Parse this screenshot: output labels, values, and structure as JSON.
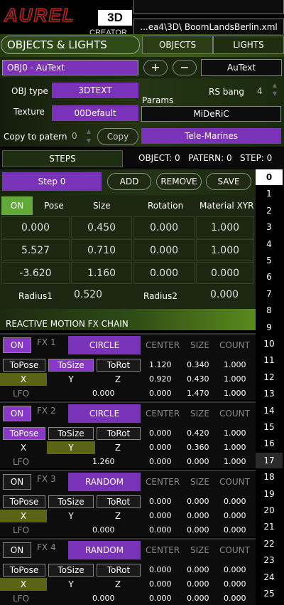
{
  "app": {
    "logo_main": "AUREL",
    "logo_3d": "3D",
    "logo_sub": "CREATOR",
    "file": "...ea4\\3D\\ BoomLandsBerlin.xml"
  },
  "header": {
    "title": "OBJECTS & LIGHTS",
    "tab_objects": "OBJECTS",
    "tab_lights": "LIGHTS"
  },
  "object": {
    "selector": "OBJ0 - AuText",
    "plus": "+",
    "minus": "−",
    "name": "AuText",
    "type_label": "OBJ type",
    "type_value": "3DTEXT",
    "rs_label": "RS bang",
    "rs_value": "4",
    "texture_label": "Texture",
    "texture_value": "00Default",
    "params_label": "Params",
    "params_value": "MiDeRiC",
    "copy_label": "Copy to patern",
    "copy_value": "0",
    "copy_button": "Copy",
    "pattern_name": "Tele-Marines"
  },
  "steps": {
    "label": "STEPS",
    "status": "OBJECT: 0   PATERN: 0   STEP: 0",
    "step_name": "Step 0",
    "add": "ADD",
    "remove": "REMOVE",
    "save": "SAVE"
  },
  "transform": {
    "on": "ON",
    "headers": [
      "Pose",
      "Size",
      "Rotation",
      "Material XYR"
    ],
    "rows": [
      [
        "0.000",
        "0.450",
        "0.000",
        "1.000"
      ],
      [
        "5.527",
        "0.710",
        "0.000",
        "1.000"
      ],
      [
        "-3.620",
        "1.160",
        "0.000",
        "0.000"
      ]
    ],
    "radius1_label": "Radius1",
    "radius1_value": "0.520",
    "radius2_label": "Radius2",
    "radius2_value": "0.000"
  },
  "fx": {
    "title": "REACTIVE MOTION FX CHAIN",
    "col_center": "CENTER",
    "col_size": "SIZE",
    "col_count": "COUNT",
    "to_pose": "ToPose",
    "to_size": "ToSize",
    "to_rot": "ToRot",
    "x": "X",
    "y": "Y",
    "z": "Z",
    "lfo": "LFO",
    "items": [
      {
        "on": "ON",
        "label": "FX 1",
        "type": "CIRCLE",
        "lfo": "0.000",
        "rows": [
          [
            "1.120",
            "0.340",
            "1.000"
          ],
          [
            "0.920",
            "0.430",
            "1.000"
          ],
          [
            "0.000",
            "1.470",
            "1.000"
          ]
        ]
      },
      {
        "on": "ON",
        "label": "FX 2",
        "type": "CIRCLE",
        "lfo": "1.260",
        "rows": [
          [
            "0.000",
            "0.420",
            "1.000"
          ],
          [
            "0.000",
            "0.360",
            "1.000"
          ],
          [
            "0.000",
            "0.000",
            "1.000"
          ]
        ]
      },
      {
        "on": "ON",
        "label": "FX 3",
        "type": "RANDOM",
        "lfo": "0.000",
        "rows": [
          [
            "0.000",
            "0.000",
            "0.000"
          ],
          [
            "0.000",
            "0.000",
            "0.000"
          ],
          [
            "0.000",
            "0.000",
            "0.000"
          ]
        ]
      },
      {
        "on": "ON",
        "label": "FX 4",
        "type": "RANDOM",
        "lfo": "0.000",
        "rows": [
          [
            "0.000",
            "0.000",
            "0.000"
          ],
          [
            "0.000",
            "0.000",
            "0.000"
          ],
          [
            "0.000",
            "0.000",
            "0.000"
          ]
        ]
      }
    ]
  },
  "step_list": [
    "0",
    "1",
    "2",
    "3",
    "4",
    "5",
    "6",
    "7",
    "8",
    "9",
    "10",
    "11",
    "12",
    "13",
    "14",
    "15",
    "16",
    "17",
    "18",
    "19",
    "20",
    "21",
    "22",
    "23",
    "24",
    "25"
  ]
}
